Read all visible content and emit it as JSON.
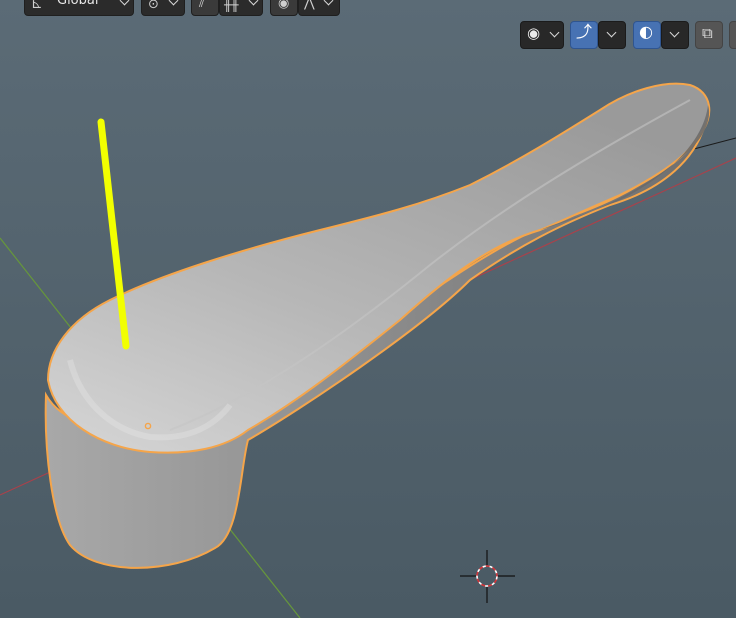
{
  "header": {
    "transform_orientation_label": "Global",
    "icons": [
      "orientation-axes-icon",
      "pivot-point-icon",
      "snap-icon",
      "snap-increment-icon",
      "proportional-edit-icon",
      "falloff-curve-icon"
    ]
  },
  "overlay_toolbar": {
    "icons": [
      "selectability-visibility-icon",
      "gizmo-icon",
      "overlays-icon",
      "xray-toggle-icon"
    ]
  },
  "colors": {
    "viewport_bg": "#526470",
    "selection_outline": "#f5a54a",
    "active_bone": "#f2ff00",
    "axis_x": "#a8424b",
    "axis_y": "#66973b",
    "ui_button": "#2b2b2b",
    "ui_active": "#4772b3"
  }
}
